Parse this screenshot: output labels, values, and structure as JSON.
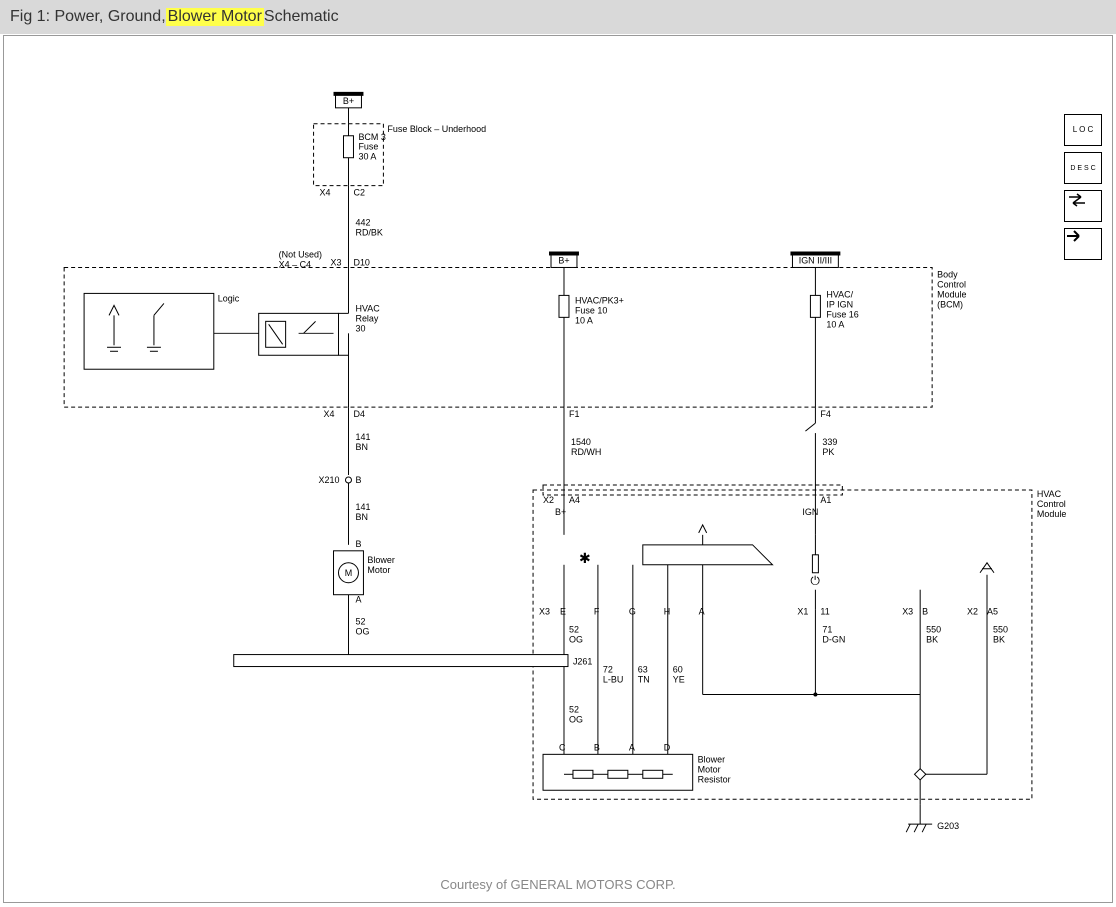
{
  "title": {
    "prefix": "Fig 1: Power, Ground, ",
    "highlight": "Blower Motor",
    "suffix": " Schematic"
  },
  "credit": "Courtesy of GENERAL MOTORS CORP.",
  "toolbar": {
    "loc": "L O C",
    "desc": "D E S C"
  },
  "power": {
    "b_plus_1": "B+",
    "b_plus_2": "B+",
    "ign": "IGN II/III"
  },
  "fuseblock": {
    "name": "Fuse Block – Underhood",
    "fuse": [
      "BCM 3",
      "Fuse",
      "30 A"
    ],
    "conn_x4": "X4",
    "conn_c2": "C2"
  },
  "wire1": {
    "num": "442",
    "color": "RD/BK"
  },
  "bcm": {
    "name": [
      "Body",
      "Control",
      "Module",
      "(BCM)"
    ],
    "notused": "(Not Used)",
    "notused_x": "X4 – C4",
    "logic": "Logic",
    "relay": [
      "HVAC",
      "Relay",
      "30"
    ],
    "fuse2": [
      "HVAC/PK3+",
      "Fuse 10",
      "10 A"
    ],
    "fuse3": [
      "HVAC/",
      "IP IGN",
      "Fuse 16",
      "10 A"
    ],
    "conn": {
      "x3": "X3",
      "d10": "D10",
      "x4": "X4",
      "d4": "D4",
      "f1": "F1",
      "f4": "F4"
    }
  },
  "wire2": {
    "num": "141",
    "color": "BN"
  },
  "wire2b": {
    "num": "141",
    "color": "BN"
  },
  "splice": {
    "x210": "X210",
    "b": "B"
  },
  "hvac_wire": {
    "num": "1540",
    "color": "RD/WH"
  },
  "ign_wire": {
    "num": "339",
    "color": "PK"
  },
  "blower": {
    "name": [
      "Blower",
      "Motor"
    ],
    "conn_b": "B",
    "conn_a": "A",
    "m": "M"
  },
  "wire3": {
    "num": "52",
    "color": "OG"
  },
  "hvac": {
    "name": [
      "HVAC",
      "Control",
      "Module"
    ],
    "conn": {
      "x2": "X2",
      "a4": "A4",
      "a1": "A1",
      "x3": "X3",
      "e": "E",
      "f": "F",
      "g": "G",
      "h": "H",
      "a": "A",
      "x1": "X1",
      "n11": "11",
      "x3b": "X3",
      "bb": "B",
      "x2b": "X2",
      "a5": "A5"
    },
    "bplus": "B+",
    "ign": "IGN"
  },
  "wire4": {
    "num": "52",
    "color": "OG"
  },
  "j261": "J261",
  "wires_fgh": {
    "f": [
      "72",
      "L-BU"
    ],
    "g": [
      "63",
      "TN"
    ],
    "h": [
      "60",
      "YE"
    ]
  },
  "wire5": {
    "num": "52",
    "color": "OG"
  },
  "wire_dgn": {
    "num": "71",
    "color": "D-GN"
  },
  "wire_bk1": {
    "num": "550",
    "color": "BK"
  },
  "wire_bk2": {
    "num": "550",
    "color": "BK"
  },
  "resistor": {
    "name": [
      "Blower",
      "Motor",
      "Resistor"
    ],
    "conn": {
      "c": "C",
      "b": "B",
      "a": "A",
      "d": "D"
    }
  },
  "ground": "G203"
}
